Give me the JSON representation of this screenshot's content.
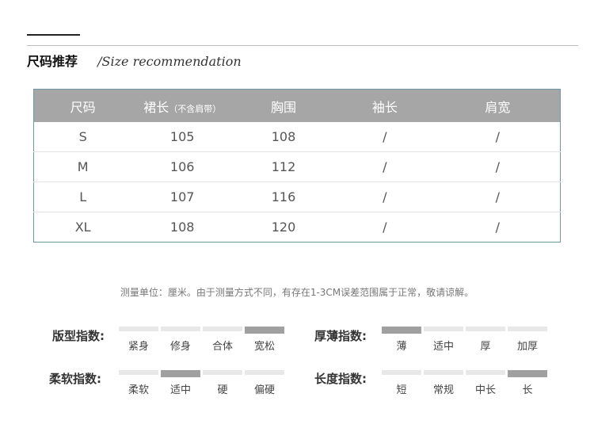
{
  "heading": {
    "cn": "尺码推荐",
    "en": "/Size recommendation"
  },
  "table": {
    "headers": [
      "尺码",
      "裙长",
      "胸围",
      "袖长",
      "肩宽"
    ],
    "header_note": "（不含肩带）",
    "rows": [
      [
        "S",
        "105",
        "108",
        "/",
        "/"
      ],
      [
        "M",
        "106",
        "112",
        "/",
        "/"
      ],
      [
        "L",
        "107",
        "116",
        "/",
        "/"
      ],
      [
        "XL",
        "108",
        "120",
        "/",
        "/"
      ]
    ]
  },
  "note": "测量单位：厘米。由于测量方式不同，有存在1-3CM误差范围属于正常，敬请谅解。",
  "indices": {
    "fit": {
      "title": "版型指数:",
      "options": [
        "紧身",
        "修身",
        "合体",
        "宽松"
      ],
      "selected": 3
    },
    "softness": {
      "title": "柔软指数:",
      "options": [
        "柔软",
        "适中",
        "硬",
        "偏硬"
      ],
      "selected": 1
    },
    "thickness": {
      "title": "厚薄指数:",
      "options": [
        "薄",
        "适中",
        "厚",
        "加厚"
      ],
      "selected": 0
    },
    "length": {
      "title": "长度指数:",
      "options": [
        "短",
        "常规",
        "中长",
        "长"
      ],
      "selected": 3
    }
  },
  "colors": {
    "header_bg": "#a6a6a6",
    "table_border": "#6f98a3",
    "active_bar": "#a0a0a0",
    "inactive_bar": "#e8e8e8"
  }
}
